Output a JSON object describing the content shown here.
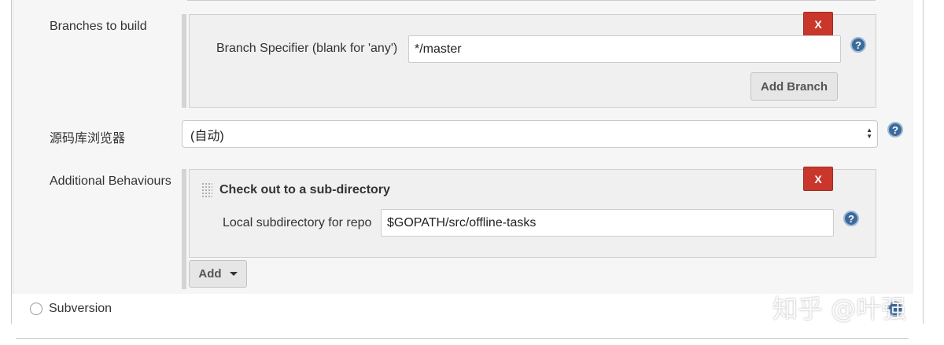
{
  "branches": {
    "label": "Branches to build",
    "specifier_label": "Branch Specifier (blank for 'any')",
    "specifier_value": "*/master",
    "delete_label": "X",
    "add_branch_label": "Add Branch",
    "help_glyph": "?"
  },
  "browser": {
    "label": "源码库浏览器",
    "selected": "(自动)",
    "help_glyph": "?"
  },
  "behaviours": {
    "label": "Additional Behaviours",
    "section_title": "Check out to a sub-directory",
    "delete_label": "X",
    "subdir_label": "Local subdirectory for repo",
    "subdir_value": "$GOPATH/src/offline-tasks",
    "add_label": "Add",
    "help_glyph": "?"
  },
  "subversion": {
    "label": "Subversion"
  },
  "watermark": {
    "text": "知乎 @叶强"
  },
  "colors": {
    "delete": "#c9372c",
    "help": "#3d6a9b",
    "panel": "#f6f6f6",
    "box": "#f0f0f0"
  }
}
